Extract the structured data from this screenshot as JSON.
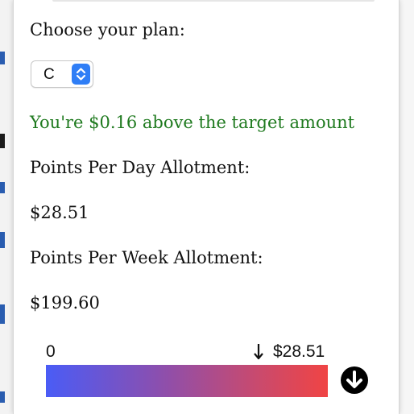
{
  "plan": {
    "heading": "Choose your plan:",
    "selected": "C"
  },
  "status": {
    "message": "You're $0.16 above the target amount",
    "color": "#1f7a1f"
  },
  "daily": {
    "label": "Points Per Day Allotment:",
    "value": "$28.51"
  },
  "weekly": {
    "label": "Points Per Week Allotment:",
    "value": "$199.60"
  },
  "scale": {
    "min_label": "0",
    "marker_label": "$28.51",
    "marker_icon": "arrow-down-icon",
    "button_icon": "arrow-circle-down-icon",
    "gradient_start": "#4a5cf6",
    "gradient_end": "#f04444"
  }
}
